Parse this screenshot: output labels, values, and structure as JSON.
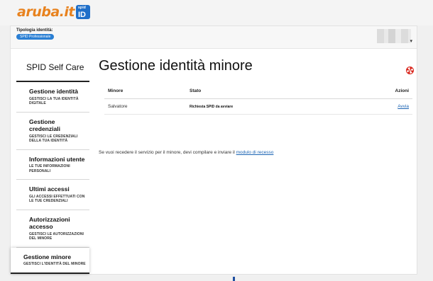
{
  "brand": {
    "logo_text": "aruba.it",
    "badge_small": "spid",
    "badge_id": "ID"
  },
  "identity": {
    "type_label": "Tipologia identità:",
    "type_value": "SPID Professionale"
  },
  "sidebar": {
    "title": "SPID Self Care",
    "items": [
      {
        "title": "Gestione identità",
        "subtitle": "GESTISCI LA TUA IDENTITÀ DIGITALE",
        "active": false
      },
      {
        "title": "Gestione credenziali",
        "subtitle": "GESTISCI LE CREDENZIALI DELLA TUA IDENTITÀ",
        "active": false
      },
      {
        "title": "Informazioni utente",
        "subtitle": "LE TUE INFORMAZIONI PERSONALI",
        "active": false
      },
      {
        "title": "Ultimi accessi",
        "subtitle": "GLI ACCESSI EFFETTUATI CON LE TUE CREDENZIALI",
        "active": false
      },
      {
        "title": "Autorizzazioni accesso",
        "subtitle": "GESTISCI LE AUTORIZZAZIONI DEL MINORE",
        "active": false
      },
      {
        "title": "Gestione minore",
        "subtitle": "GESTISCI L'IDENTITÀ DEL MINORE",
        "active": true
      }
    ]
  },
  "main": {
    "title": "Gestione identità minore",
    "table": {
      "headers": {
        "minore": "Minore",
        "stato": "Stato",
        "azioni": "Azioni"
      },
      "rows": [
        {
          "minore": "Salvatore",
          "stato": "Richiesta SPID da avviare",
          "azione": "Avvia"
        }
      ]
    },
    "note_text": "Se vuoi recedere il servizio per il minore, devi compilare e inviare il ",
    "note_link": "modulo di recesso"
  },
  "colors": {
    "accent": "#1f6fc9",
    "brand_orange": "#e8821e",
    "link": "#1a63b3"
  }
}
